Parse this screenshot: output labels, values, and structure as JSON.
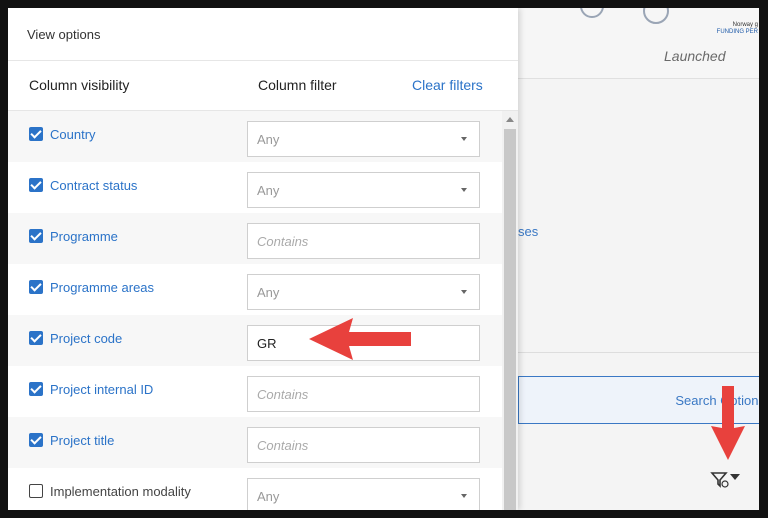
{
  "background": {
    "launched_label": "Launched",
    "logo_line1": "Norway g",
    "logo_line2": "FUNDING PER",
    "ses_fragment": "ses",
    "search_button": "Search Options"
  },
  "panel": {
    "title": "View options",
    "column_visibility_header": "Column visibility",
    "column_filter_header": "Column filter",
    "clear_filters": "Clear filters",
    "rows": [
      {
        "label": "Country",
        "checked": true,
        "filter_type": "select",
        "value": "Any"
      },
      {
        "label": "Contract status",
        "checked": true,
        "filter_type": "select",
        "value": "Any"
      },
      {
        "label": "Programme",
        "checked": true,
        "filter_type": "text",
        "placeholder": "Contains"
      },
      {
        "label": "Programme areas",
        "checked": true,
        "filter_type": "select",
        "value": "Any"
      },
      {
        "label": "Project code",
        "checked": true,
        "filter_type": "text",
        "value": "GR"
      },
      {
        "label": "Project internal ID",
        "checked": true,
        "filter_type": "text",
        "placeholder": "Contains"
      },
      {
        "label": "Project title",
        "checked": true,
        "filter_type": "text",
        "placeholder": "Contains"
      },
      {
        "label": "Implementation modality",
        "checked": false,
        "filter_type": "select",
        "value": "Any"
      }
    ]
  },
  "colors": {
    "accent": "#2b73c8",
    "annotation_arrow": "#e8413d"
  }
}
